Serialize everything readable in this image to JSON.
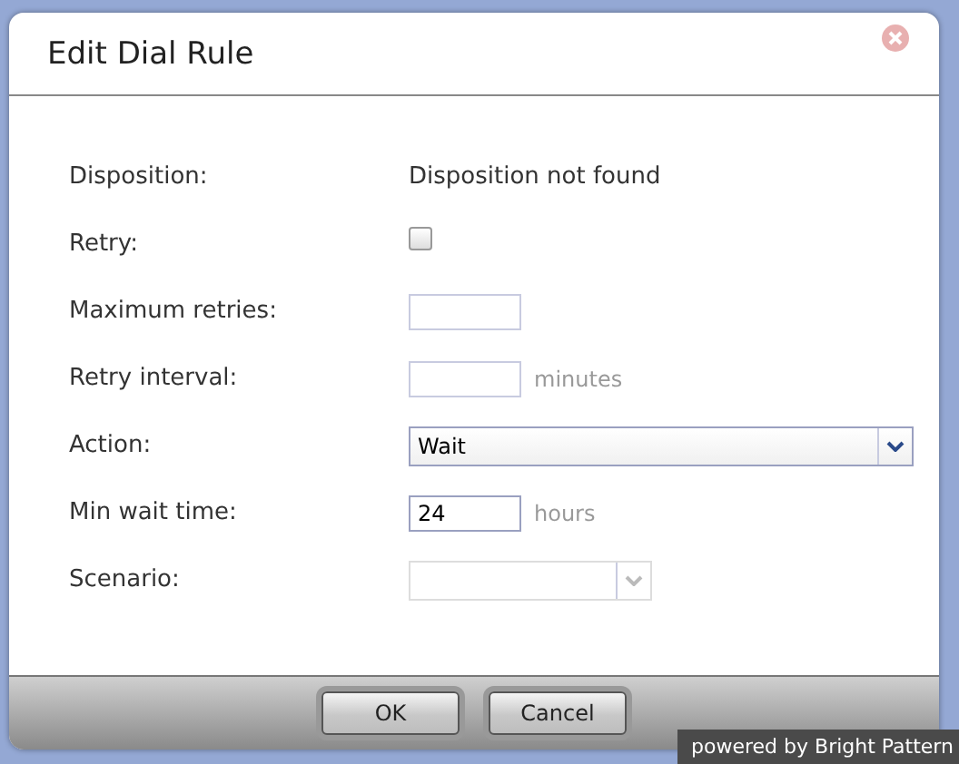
{
  "dialog": {
    "title": "Edit Dial Rule",
    "fields": [
      {
        "kind": "text",
        "label": "Disposition:",
        "value": "Disposition not found"
      },
      {
        "kind": "checkbox",
        "label": "Retry:",
        "checked": false
      },
      {
        "kind": "input",
        "label": "Maximum retries:"
      },
      {
        "kind": "input",
        "label": "Retry interval:",
        "unit": "minutes"
      },
      {
        "kind": "select",
        "label": "Action:",
        "value": "Wait",
        "disabled": false
      },
      {
        "kind": "input",
        "label": "Min wait time:",
        "value": "24",
        "unit": "hours"
      },
      {
        "kind": "select",
        "label": "Scenario:",
        "disabled": true
      }
    ],
    "buttons": [
      "OK",
      "Cancel"
    ]
  },
  "badge": "powered by Bright Pattern"
}
